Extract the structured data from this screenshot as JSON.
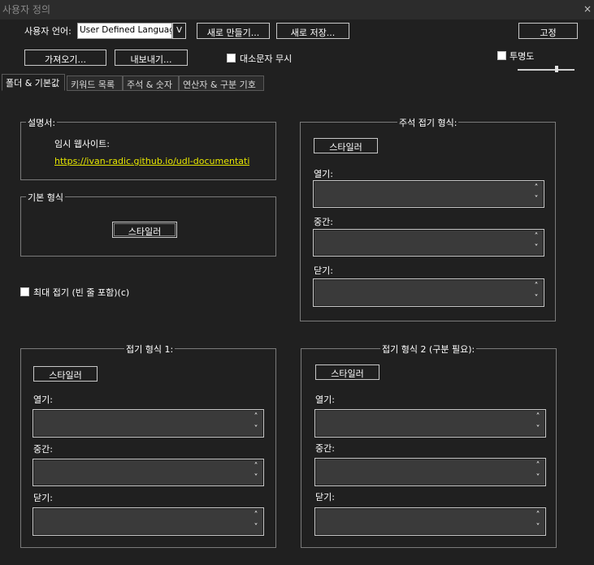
{
  "window": {
    "title": "사용자 정의",
    "close_icon": "×"
  },
  "toolbar": {
    "language_label": "사용자 언어:",
    "language_value": "User Defined Language",
    "dropdown_glyph": "V",
    "new_button": "새로 만들기...",
    "save_as_button": "새로 저장...",
    "dock_button": "고정",
    "import_button": "가져오기...",
    "export_button": "내보내기...",
    "ignore_case_label": "대소문자 무시",
    "transparency_label": "투명도"
  },
  "tabs": [
    {
      "label": "폴더 & 기본값",
      "active": true
    },
    {
      "label": "키워드 목록",
      "active": false
    },
    {
      "label": "주석 & 숫자",
      "active": false
    },
    {
      "label": "연산자 & 구분 기호",
      "active": false
    }
  ],
  "documentation": {
    "title": "설명서:",
    "temp_site_label": "임시 웹사이트:",
    "link": "https://ivan-radic.github.io/udl-documentation/"
  },
  "default_style": {
    "title": "기본 형식",
    "styler_button": "스타일러"
  },
  "fold_compact_label": "최대 접기 (빈 줄 포함)(c)",
  "comment_fold": {
    "title": "주석 접기 형식:",
    "styler_button": "스타일러",
    "open_label": "열기:",
    "middle_label": "중간:",
    "close_label": "닫기:"
  },
  "fold_style1": {
    "title": "접기 형식 1:",
    "styler_button": "스타일러",
    "open_label": "열기:",
    "middle_label": "중간:",
    "close_label": "닫기:"
  },
  "fold_style2": {
    "title": "접기 형식 2 (구분 필요):",
    "styler_button": "스타일러",
    "open_label": "열기:",
    "middle_label": "중간:",
    "close_label": "닫기:"
  },
  "scroll_icons": {
    "up": "˄",
    "down": "˅"
  }
}
